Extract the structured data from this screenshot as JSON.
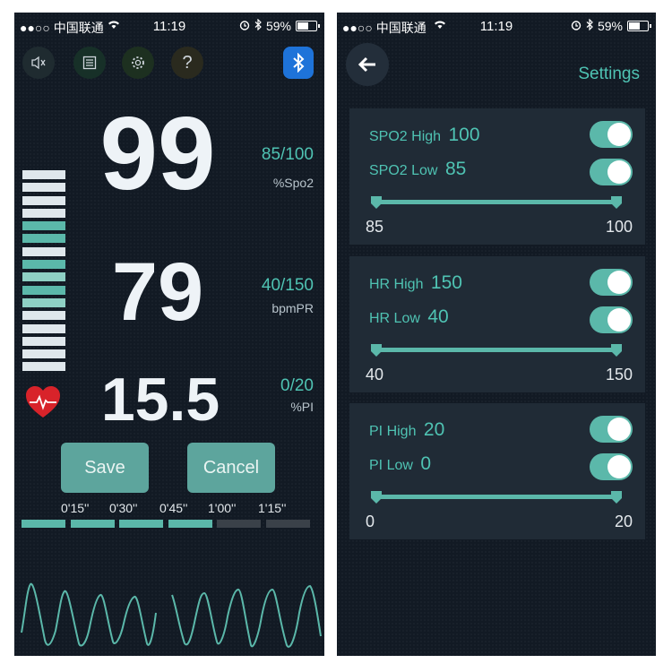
{
  "status_bar": {
    "carrier": "●●○○ 中国联通",
    "time": "11:19",
    "battery": "59%",
    "battery_level": 0.59,
    "wifi_icon": "wifi-icon",
    "alarm_icon": "alarm-icon",
    "bluetooth_icon": "bluetooth-icon"
  },
  "monitor": {
    "toolbar": [
      "mute-icon",
      "list-icon",
      "gear-icon",
      "help-icon",
      "bluetooth-icon"
    ],
    "spo2": {
      "value": "99",
      "range": "85/100",
      "unit": "%Spo2"
    },
    "pr": {
      "value": "79",
      "range": "40/150",
      "unit": "bpmPR"
    },
    "pi": {
      "value": "15.5",
      "range": "0/20",
      "unit": "%PI"
    },
    "bar_count": 16,
    "save_label": "Save",
    "cancel_label": "Cancel",
    "timeline": {
      "labels": [
        "0'15''",
        "0'30''",
        "0'45''",
        "1'00''",
        "1'15''"
      ],
      "segments_filled": 4,
      "segments_total": 6
    },
    "colors": {
      "accent": "#5bb8aa",
      "background": "#121a24",
      "heart": "#d8232a"
    }
  },
  "settings": {
    "back_icon": "arrow-left-icon",
    "title": "Settings",
    "panels": [
      {
        "high_label": "SPO2 High",
        "high_value": "100",
        "low_label": "SPO2 Low",
        "low_value": "85",
        "high_enabled": true,
        "low_enabled": true,
        "range_min": "85",
        "range_max": "100"
      },
      {
        "high_label": "HR High",
        "high_value": "150",
        "low_label": "HR Low",
        "low_value": "40",
        "high_enabled": true,
        "low_enabled": true,
        "range_min": "40",
        "range_max": "150"
      },
      {
        "high_label": "PI High",
        "high_value": "20",
        "low_label": "PI Low",
        "low_value": "0",
        "high_enabled": true,
        "low_enabled": true,
        "range_min": "0",
        "range_max": "20"
      }
    ]
  }
}
